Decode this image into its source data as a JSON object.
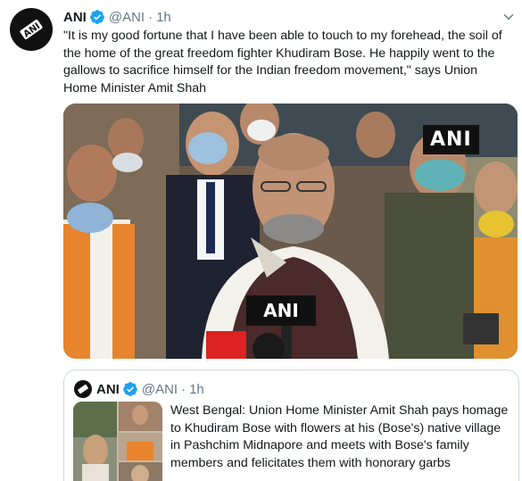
{
  "tweet": {
    "display_name": "ANI",
    "handle": "@ANI",
    "separator": "·",
    "time": "1h",
    "text": "\"It is my good fortune that I have been able to touch to my forehead, the soil of the home of the great freedom fighter Khudiram Bose. He happily went to the gallows to sacrifice himself for the Indian freedom movement,\" says Union Home Minister Amit Shah",
    "avatar_label": "ANI",
    "media": {
      "watermark": "ANI",
      "mic_label": "ANI"
    }
  },
  "quoted_tweet": {
    "display_name": "ANI",
    "handle": "@ANI",
    "separator": "·",
    "time": "1h",
    "text": "West Bengal: Union Home Minister Amit Shah pays homage to Khudiram Bose with flowers at his (Bose's) native village in Pashchim Midnapore and meets with Bose's family members and felicitates them with honorary garbs"
  },
  "colors": {
    "verified": "#1da1f2",
    "primary_text": "#14171a",
    "secondary_text": "#657786",
    "border": "#cfd9de"
  },
  "icons": {
    "verified": "verified-badge-icon",
    "more": "chevron-down-icon"
  }
}
